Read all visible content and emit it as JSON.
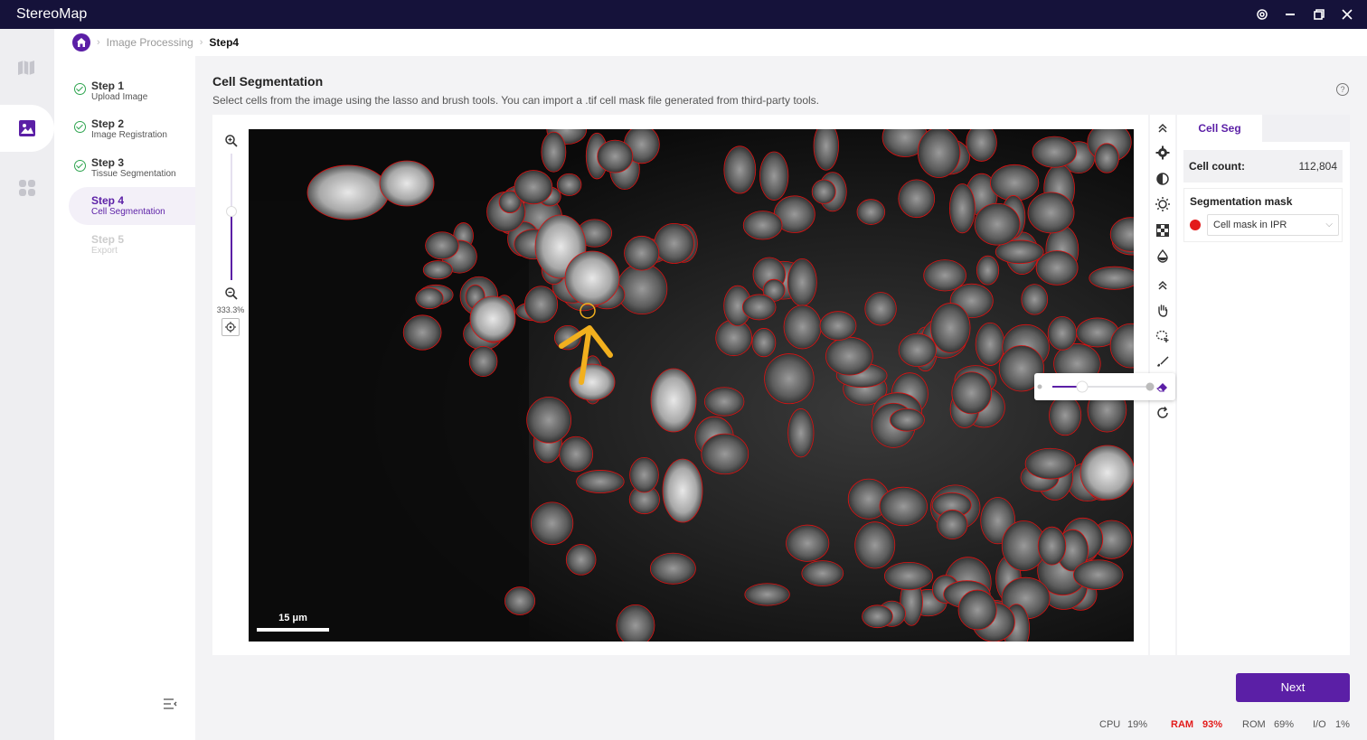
{
  "app": {
    "title": "StereoMap"
  },
  "breadcrumb": {
    "items": [
      "Image Processing",
      "Step4"
    ]
  },
  "steps": [
    {
      "title": "Step 1",
      "subtitle": "Upload Image",
      "state": "done"
    },
    {
      "title": "Step 2",
      "subtitle": "Image Registration",
      "state": "done"
    },
    {
      "title": "Step 3",
      "subtitle": "Tissue Segmentation",
      "state": "done"
    },
    {
      "title": "Step 4",
      "subtitle": "Cell Segmentation",
      "state": "current"
    },
    {
      "title": "Step 5",
      "subtitle": "Export",
      "state": "disabled"
    }
  ],
  "header": {
    "title": "Cell Segmentation",
    "description": "Select cells from the image using the lasso and brush tools. You can import a .tif cell mask file generated from third-party tools."
  },
  "zoom": {
    "label": "333.3%",
    "level": 0.45
  },
  "scalebar": {
    "label": "15 μm"
  },
  "brush_size": {
    "level": 0.3
  },
  "side_panel": {
    "tab": "Cell Seg",
    "cell_count_label": "Cell count:",
    "cell_count_value": "112,804",
    "mask_label": "Segmentation mask",
    "mask_selected": "Cell mask in IPR",
    "mask_color": "#e31b1b"
  },
  "next_button": {
    "label": "Next"
  },
  "status": {
    "cpu_label": "CPU",
    "cpu_value": "19%",
    "ram_label": "RAM",
    "ram_value": "93%",
    "rom_label": "ROM",
    "rom_value": "69%",
    "io_label": "I/O",
    "io_value": "1%"
  },
  "colors": {
    "accent": "#5b1fa6",
    "titlebar": "#15123a",
    "warning": "#e31b1b",
    "annotation": "#f2b01e"
  }
}
